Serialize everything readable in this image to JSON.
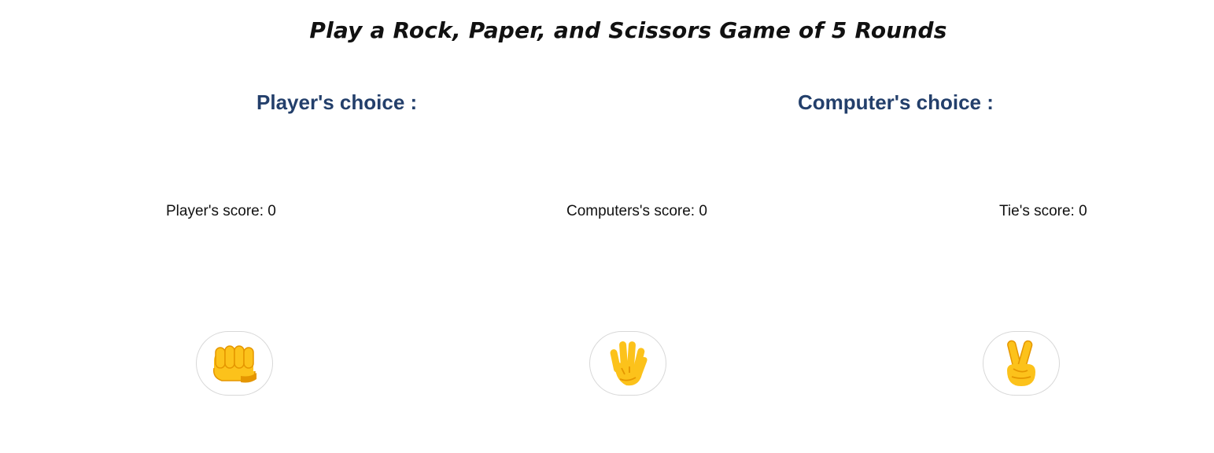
{
  "header": {
    "title": "Play a Rock, Paper, and Scissors Game of 5 Rounds"
  },
  "choices": {
    "player_heading": "Player's choice :",
    "computer_heading": "Computer's choice :"
  },
  "scores": {
    "player": "Player's score: 0",
    "computer": "Computers's score: 0",
    "tie": "Tie's score: 0"
  },
  "buttons": [
    {
      "name": "rock",
      "icon": "fist-icon"
    },
    {
      "name": "paper",
      "icon": "raised-hand-icon"
    },
    {
      "name": "scissors",
      "icon": "victory-hand-icon"
    }
  ],
  "colors": {
    "heading": "#233f6b",
    "emoji_skin": "#fcc21b",
    "emoji_shade": "#e59600"
  }
}
